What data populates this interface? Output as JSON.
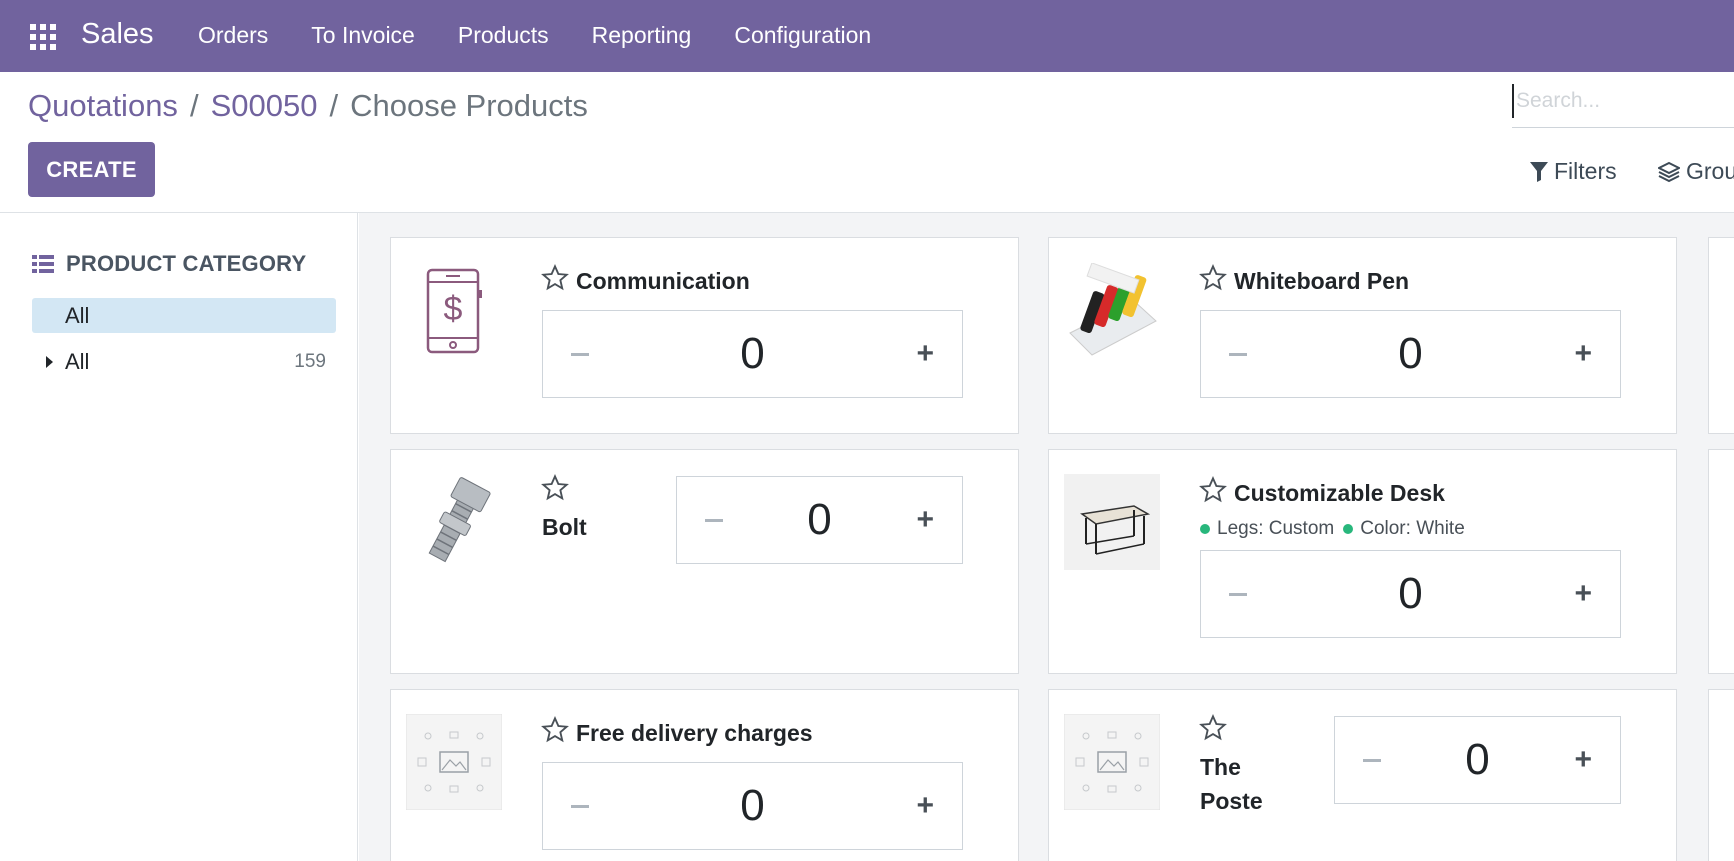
{
  "navbar": {
    "app_name": "Sales",
    "menu": [
      "Orders",
      "To Invoice",
      "Products",
      "Reporting",
      "Configuration"
    ],
    "apps_icon": "grid-icon",
    "color": "#71639e"
  },
  "breadcrumb": {
    "items": [
      "Quotations",
      "S00050"
    ],
    "current": "Choose Products",
    "separator": "/"
  },
  "toolbar": {
    "create_label": "CREATE",
    "search_placeholder": "Search...",
    "filters_label": "Filters",
    "groupby_label": "Grou"
  },
  "sidebar": {
    "title": "PRODUCT CATEGORY",
    "title_icon": "list-icon",
    "selected_label": "All",
    "tree_label": "All",
    "tree_count": "159"
  },
  "products": [
    {
      "name": "Communication",
      "qty": "0",
      "image": "phone-dollar-icon"
    },
    {
      "name": "Whiteboard Pen",
      "qty": "0",
      "image": "whiteboard-pen-image"
    },
    {
      "name": "Bolt",
      "qty": "0",
      "image": "bolt-image"
    },
    {
      "name": "Customizable Desk",
      "qty": "0",
      "image": "desk-image",
      "attributes": [
        "Legs: Custom",
        "Color: White"
      ]
    },
    {
      "name": "Free delivery charges",
      "qty": "0",
      "image": "placeholder-image"
    },
    {
      "name_line1": "The",
      "name_line2": "Poste",
      "qty": "0",
      "image": "placeholder-image"
    }
  ],
  "colors": {
    "accent": "#71639e",
    "attribute_dot": "#28b77c",
    "selected_bg": "#d3e7f4"
  }
}
